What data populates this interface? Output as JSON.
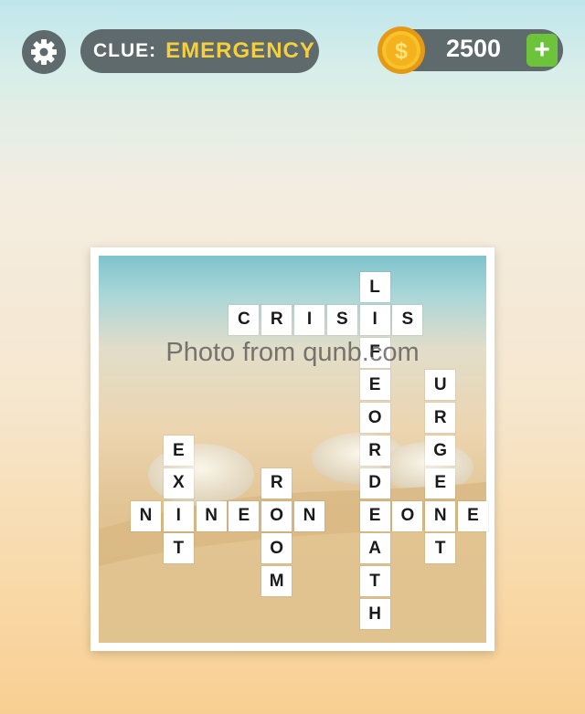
{
  "header": {
    "clue_label": "CLUE:",
    "clue_word": "EMERGENCY",
    "coins": "2500",
    "plus_label": "+",
    "settings_icon": "gear-icon",
    "coin_icon": "coin-icon",
    "coin_symbol": "$"
  },
  "watermark": "Photo from qunb.com",
  "puzzle": {
    "words": [
      "CRISIS",
      "LIFE OR DEATH",
      "URGENT",
      "EXIT",
      "ROOM",
      "NINE ONE ONE"
    ],
    "tiles": [
      {
        "letter": "L",
        "col": 7,
        "row": 0
      },
      {
        "letter": "C",
        "col": 3,
        "row": 1
      },
      {
        "letter": "R",
        "col": 4,
        "row": 1
      },
      {
        "letter": "I",
        "col": 5,
        "row": 1
      },
      {
        "letter": "S",
        "col": 6,
        "row": 1
      },
      {
        "letter": "I",
        "col": 7,
        "row": 1
      },
      {
        "letter": "S",
        "col": 8,
        "row": 1
      },
      {
        "letter": "F",
        "col": 7,
        "row": 2
      },
      {
        "letter": "E",
        "col": 7,
        "row": 3
      },
      {
        "letter": "U",
        "col": 9,
        "row": 3
      },
      {
        "letter": "O",
        "col": 7,
        "row": 4
      },
      {
        "letter": "R",
        "col": 9,
        "row": 4
      },
      {
        "letter": "E",
        "col": 1,
        "row": 5
      },
      {
        "letter": "R",
        "col": 7,
        "row": 5
      },
      {
        "letter": "G",
        "col": 9,
        "row": 5
      },
      {
        "letter": "X",
        "col": 1,
        "row": 6
      },
      {
        "letter": "R",
        "col": 4,
        "row": 6
      },
      {
        "letter": "D",
        "col": 7,
        "row": 6
      },
      {
        "letter": "E",
        "col": 9,
        "row": 6
      },
      {
        "letter": "N",
        "col": 0,
        "row": 7
      },
      {
        "letter": "I",
        "col": 1,
        "row": 7
      },
      {
        "letter": "N",
        "col": 2,
        "row": 7
      },
      {
        "letter": "E",
        "col": 3,
        "row": 7
      },
      {
        "letter": "O",
        "col": 4,
        "row": 7
      },
      {
        "letter": "N",
        "col": 5,
        "row": 7
      },
      {
        "letter": "E",
        "col": 7,
        "row": 7
      },
      {
        "letter": "O",
        "col": 8,
        "row": 7
      },
      {
        "letter": "N",
        "col": 9,
        "row": 7
      },
      {
        "letter": "E",
        "col": 10,
        "row": 7
      },
      {
        "letter": "T",
        "col": 1,
        "row": 8
      },
      {
        "letter": "O",
        "col": 4,
        "row": 8
      },
      {
        "letter": "A",
        "col": 7,
        "row": 8
      },
      {
        "letter": "T",
        "col": 9,
        "row": 8
      },
      {
        "letter": "M",
        "col": 4,
        "row": 9
      },
      {
        "letter": "T",
        "col": 7,
        "row": 9
      },
      {
        "letter": "H",
        "col": 7,
        "row": 10
      }
    ]
  }
}
